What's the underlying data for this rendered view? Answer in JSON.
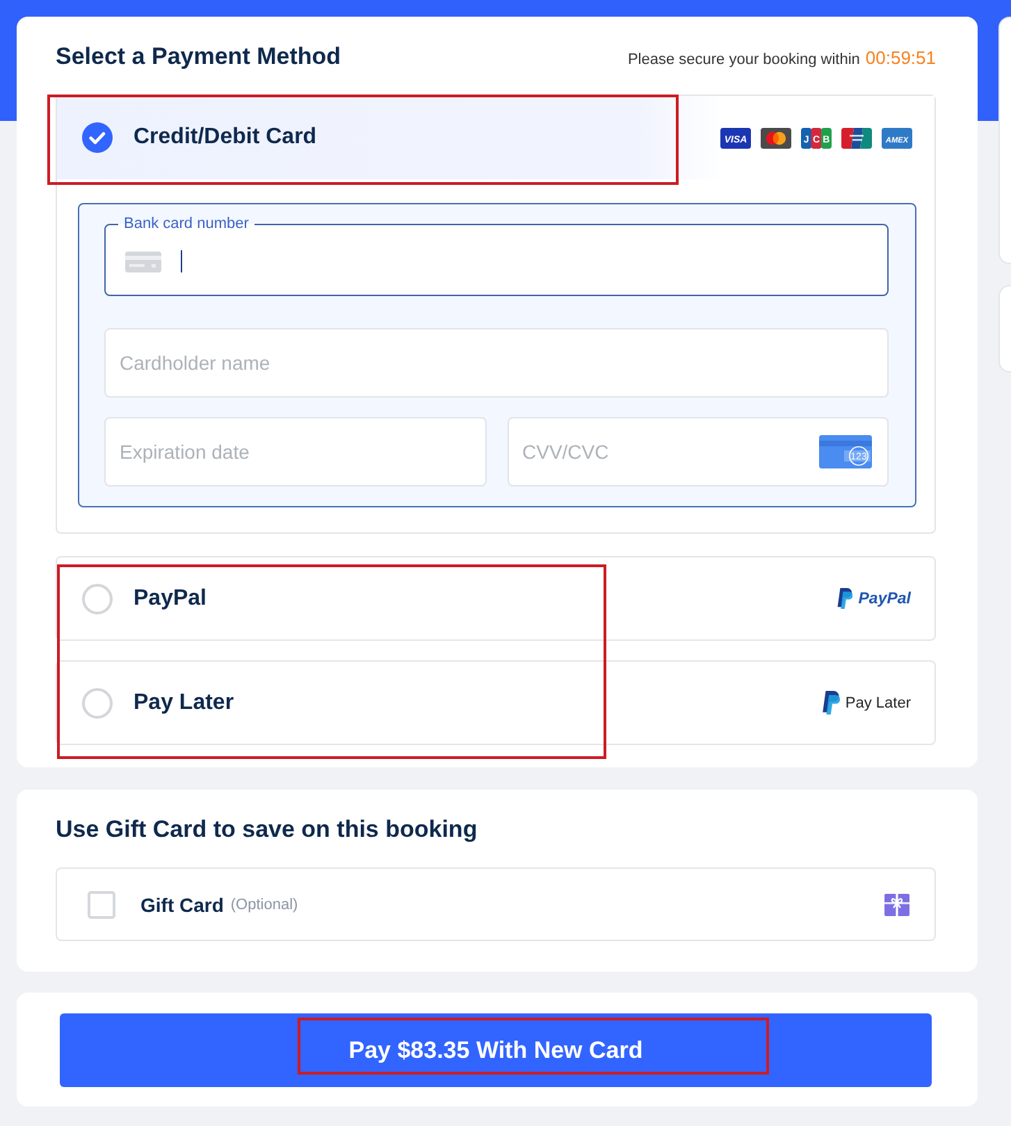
{
  "header": {
    "title": "Select a Payment Method",
    "notice": "Please secure your booking within",
    "countdown": "00:59:51"
  },
  "card_method": {
    "label": "Credit/Debit Card",
    "selected": true,
    "highlighted": true,
    "brands": [
      {
        "kind": "visa",
        "text": "VISA"
      },
      {
        "kind": "mastercard"
      },
      {
        "kind": "jcb",
        "text": "JCB"
      },
      {
        "kind": "unionpay"
      },
      {
        "kind": "amex",
        "text": "AMEX"
      }
    ],
    "fields": [
      {
        "kind": "card_number",
        "label": "Bank card number",
        "focused": true
      },
      {
        "kind": "name",
        "placeholder": "Cardholder name"
      },
      {
        "kind": "expiry",
        "placeholder": "Expiration date"
      },
      {
        "kind": "cvv",
        "placeholder": "CVV/CVC",
        "icon_text": "123"
      }
    ]
  },
  "other_methods": {
    "highlighted": true,
    "items": [
      {
        "kind": "paypal",
        "label": "PayPal",
        "selected": false,
        "logo_text": "PayPal"
      },
      {
        "kind": "pay_later",
        "label": "Pay Later",
        "selected": false,
        "logo_text": "Pay Later"
      }
    ]
  },
  "gift_card": {
    "title": "Use Gift Card to save on this booking",
    "label": "Gift Card",
    "note": "(Optional)",
    "checked": false
  },
  "pay_button": {
    "label": "Pay $83.35 With New Card",
    "highlighted": true
  }
}
